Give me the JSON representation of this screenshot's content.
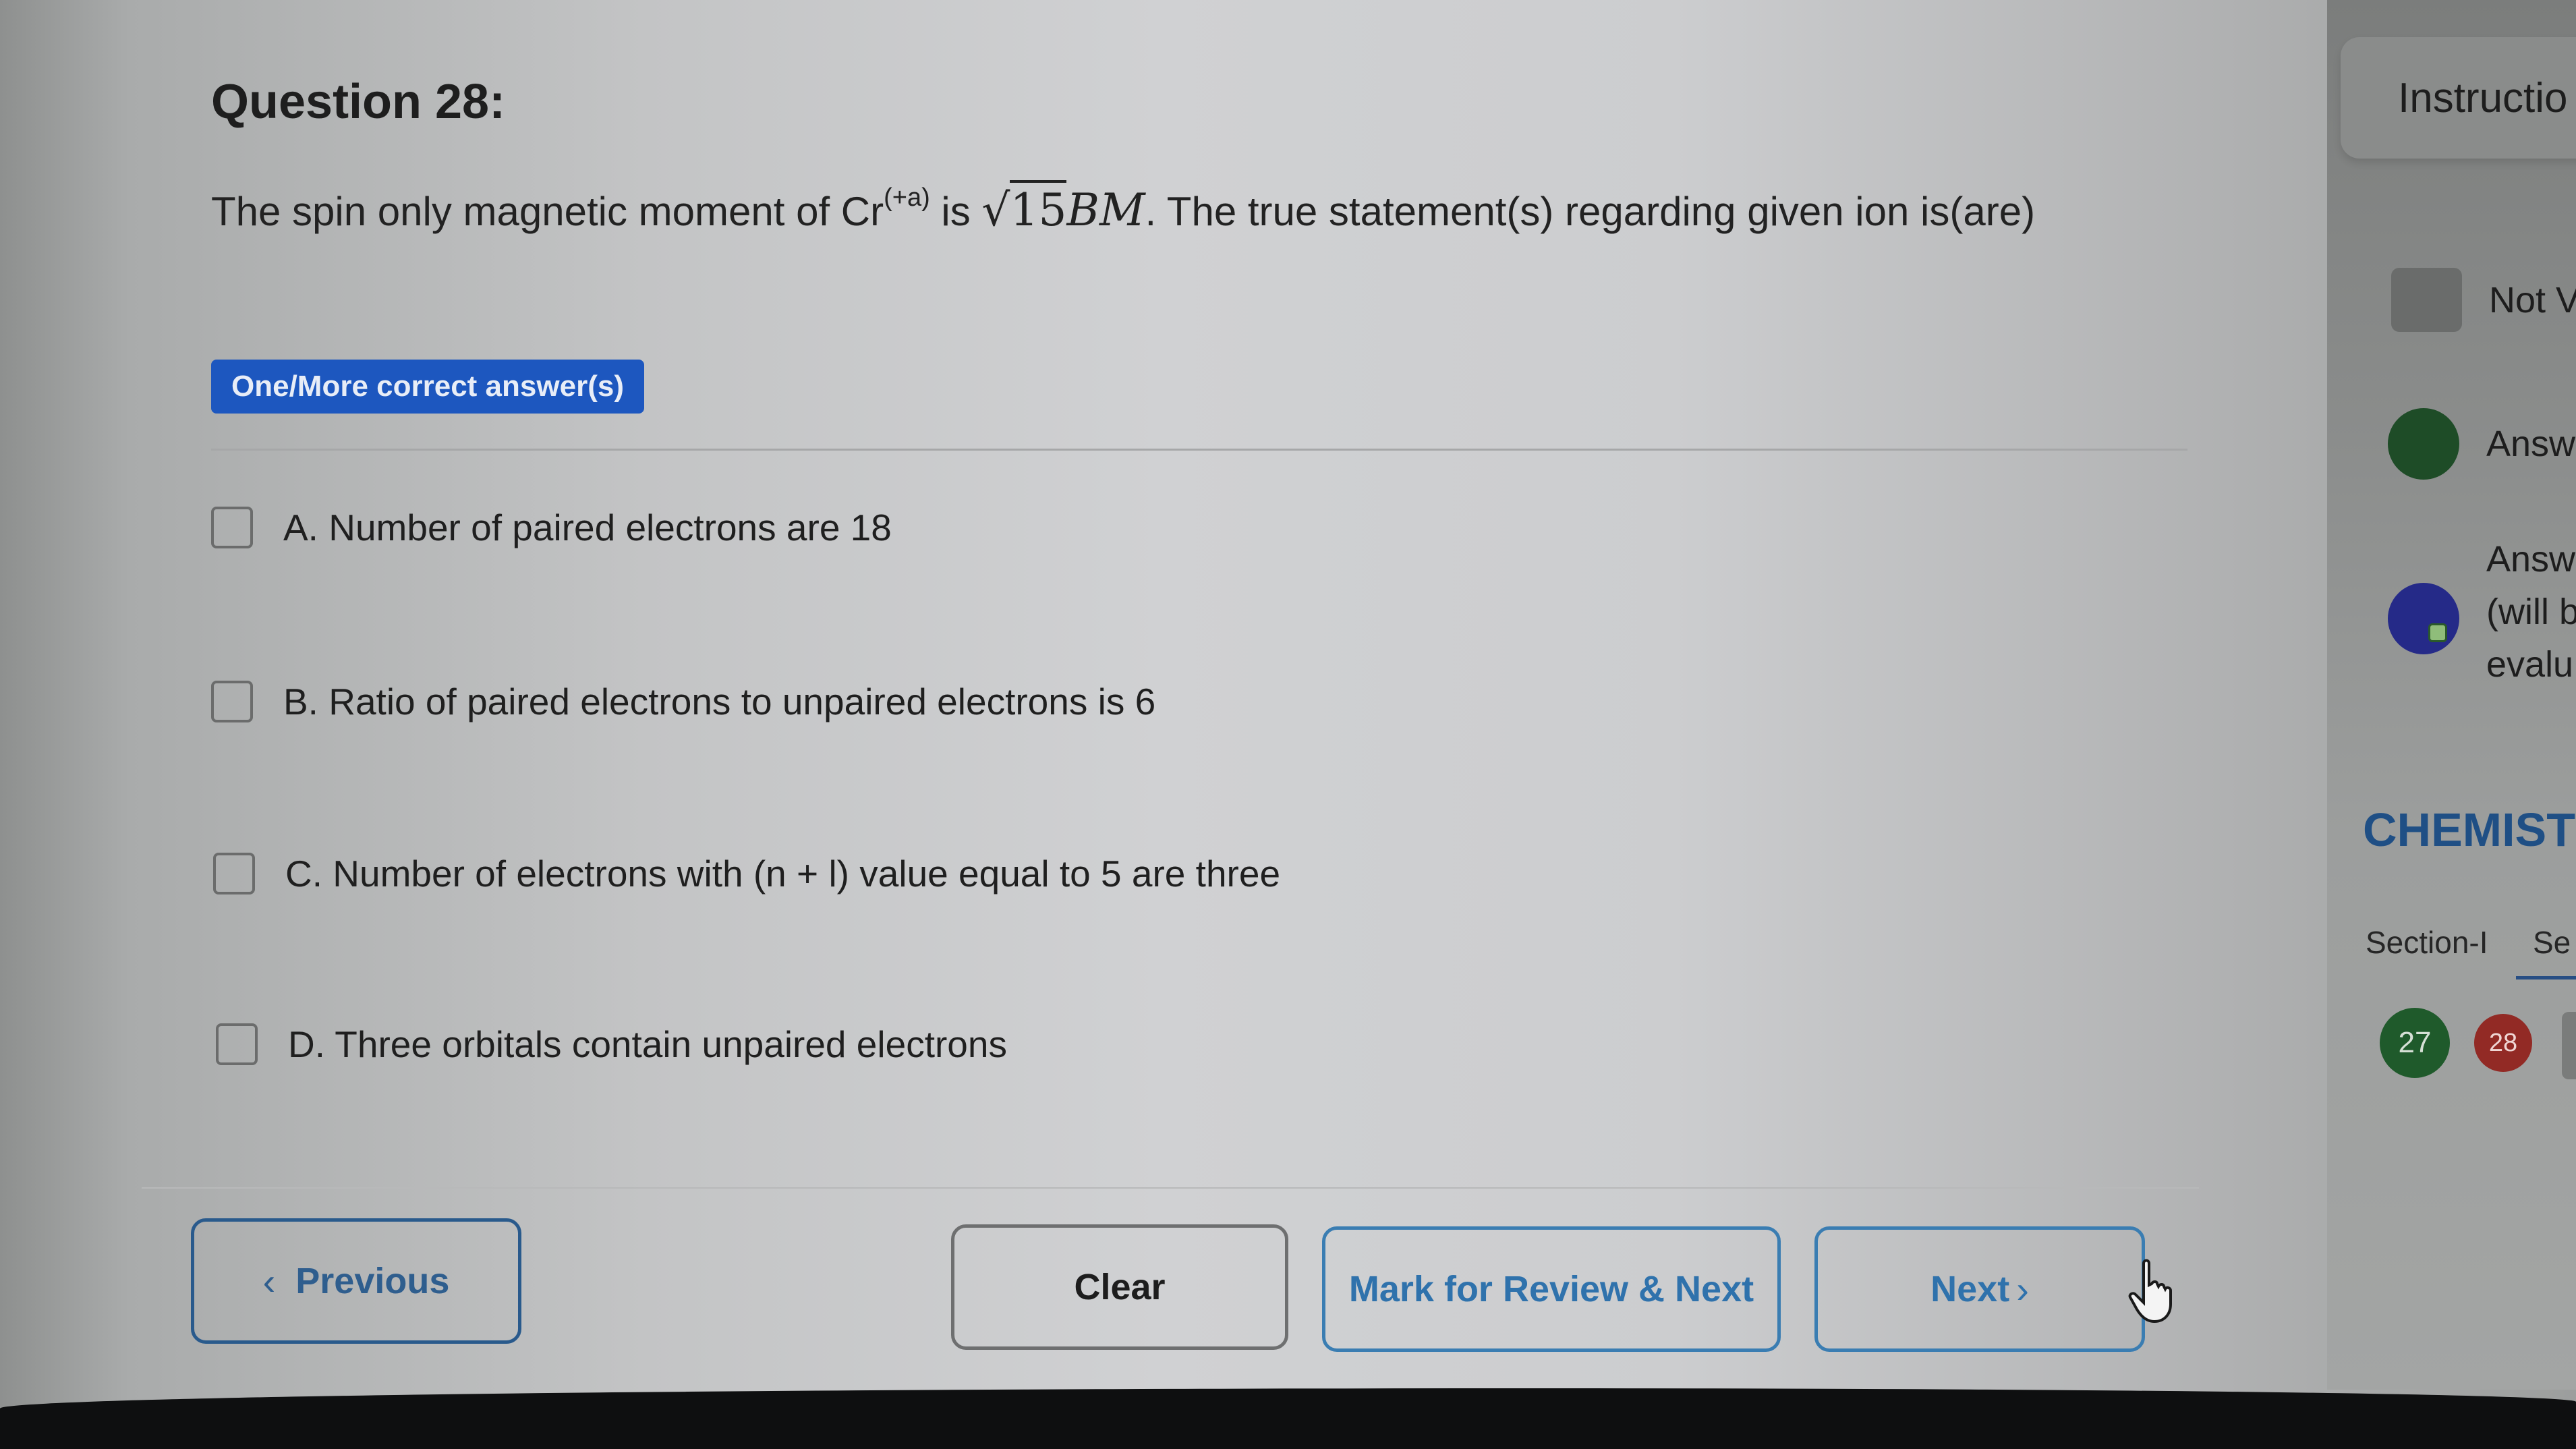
{
  "question": {
    "title": "Question 28:",
    "text_before": "The spin only magnetic moment of Cr",
    "superscript": "(+a)",
    "text_is": " is ",
    "sqrt_value": "15",
    "unit": "BM",
    "text_after": ". The true statement(s) regarding given ion is(are)",
    "type_badge": "One/More correct answer(s)",
    "options": [
      {
        "label": "A. Number of paired electrons are 18",
        "checked": false
      },
      {
        "label": "B. Ratio of paired electrons to unpaired electrons is 6",
        "checked": false
      },
      {
        "label": "C. Number of electrons with (n + l) value equal to 5 are three",
        "checked": false
      },
      {
        "label": "D. Three orbitals contain unpaired electrons",
        "checked": false
      }
    ]
  },
  "footer": {
    "previous_label": "Previous",
    "previous_icon": "chevron-left-icon",
    "clear_label": "Clear",
    "mark_review_label": "Mark for Review & Next",
    "next_label": "Next",
    "next_icon": "chevron-right-icon"
  },
  "sidebar": {
    "instructions_label": "Instructio",
    "legend": [
      {
        "status": "not-visited",
        "label": "Not V"
      },
      {
        "status": "answered",
        "label": "Answ"
      },
      {
        "status": "answered-marked",
        "label_lines": [
          "Answ",
          "(will b",
          "evalu"
        ]
      }
    ],
    "subject": "CHEMISTR",
    "sections": [
      {
        "label": "Section-I",
        "active": false
      },
      {
        "label": "Se",
        "active": true
      }
    ],
    "question_palette": [
      {
        "number": "27",
        "status": "answered"
      },
      {
        "number": "28",
        "status": "current"
      }
    ]
  },
  "colors": {
    "badge_bg": "#1d57bf",
    "primary_blue": "#2f72ac",
    "answered_green": "#1f5a2b",
    "current_red": "#922a25",
    "marked_blue": "#252a88",
    "subject_blue": "#1f4f85"
  }
}
